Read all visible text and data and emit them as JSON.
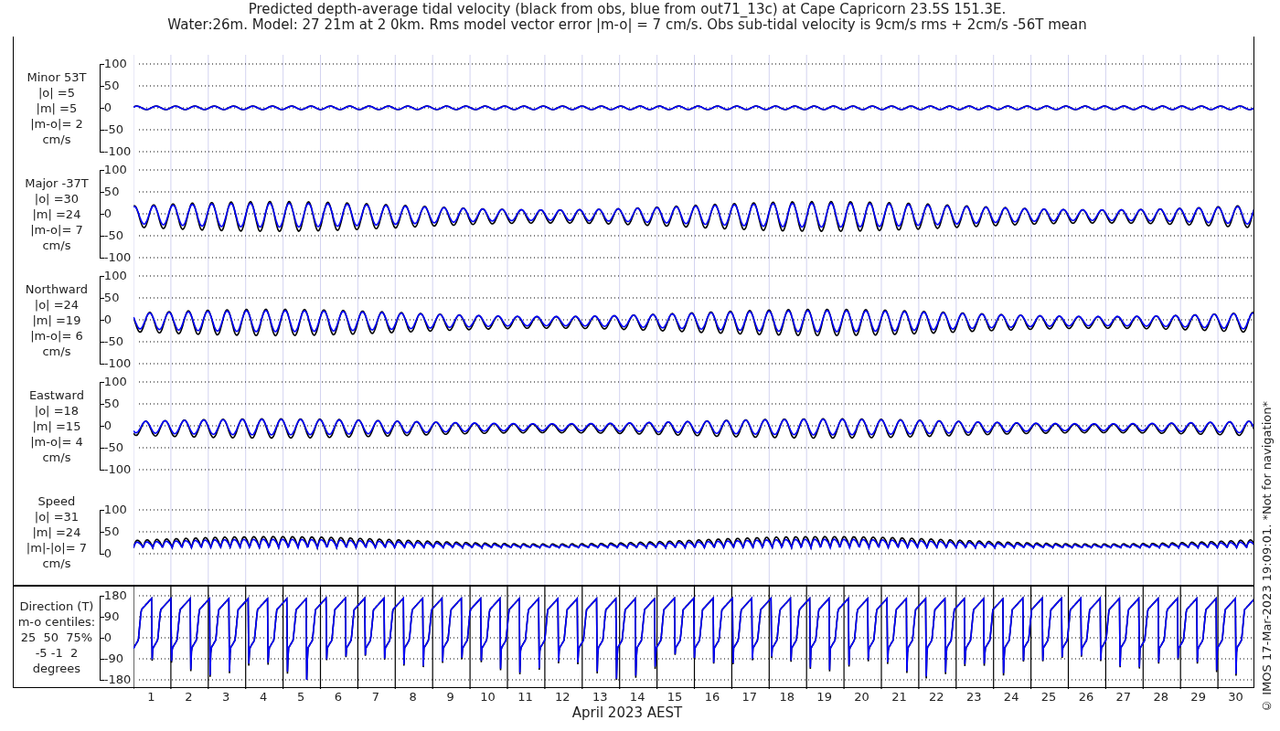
{
  "title": [
    "Predicted depth-average tidal velocity (black from obs, blue from out71_13c) at Cape Capricorn 23.5S 151.3E.",
    "Water:26m. Model: 27 21m at 2 0km. Rms model vector error |m-o| = 7 cm/s. Obs sub-tidal velocity is 9cm/s rms + 2cm/s -56T mean"
  ],
  "panels": [
    {
      "kind": "flat",
      "lines": [
        "Minor 53T",
        "|o| =5",
        "|m| =5",
        "|m-o|= 2",
        "cm/s"
      ],
      "yticks": [
        "100",
        "50",
        "0",
        "-50",
        "-100"
      ]
    },
    {
      "kind": "tidal",
      "lines": [
        "Major -37T",
        "|o| =30",
        "|m| =24",
        "|m-o|= 7",
        "cm/s"
      ],
      "yticks": [
        "100",
        "50",
        "0",
        "-50",
        "-100"
      ]
    },
    {
      "kind": "tidal",
      "lines": [
        "Northward",
        "|o| =24",
        "|m| =19",
        "|m-o|= 6",
        "cm/s"
      ],
      "yticks": [
        "100",
        "50",
        "0",
        "-50",
        "-100"
      ]
    },
    {
      "kind": "tidal",
      "lines": [
        "Eastward",
        "|o| =18",
        "|m| =15",
        "|m-o|= 4",
        "cm/s"
      ],
      "yticks": [
        "100",
        "50",
        "0",
        "-50",
        "-100"
      ]
    },
    {
      "kind": "speed",
      "lines": [
        "Speed",
        "|o| =31",
        "|m| =24",
        "|m|-|o|= 7",
        "cm/s"
      ],
      "yticks": [
        "100",
        "50",
        "0"
      ]
    },
    {
      "kind": "direction",
      "lines": [
        "Direction (T)",
        "m-o centiles:",
        "25  50  75%",
        "-5 -1  2",
        "degrees"
      ],
      "yticks": [
        "180",
        "90",
        "0",
        "-90",
        "-180"
      ]
    }
  ],
  "x_axis": {
    "ticks": [
      "1",
      "2",
      "3",
      "4",
      "5",
      "6",
      "7",
      "8",
      "9",
      "10",
      "11",
      "12",
      "13",
      "14",
      "15",
      "16",
      "17",
      "18",
      "19",
      "20",
      "21",
      "22",
      "23",
      "24",
      "25",
      "26",
      "27",
      "28",
      "29",
      "30"
    ],
    "label": "April 2023 AEST"
  },
  "footer": "© IMOS 17-Mar-2023 19:09:01. *Not for navigation*"
}
